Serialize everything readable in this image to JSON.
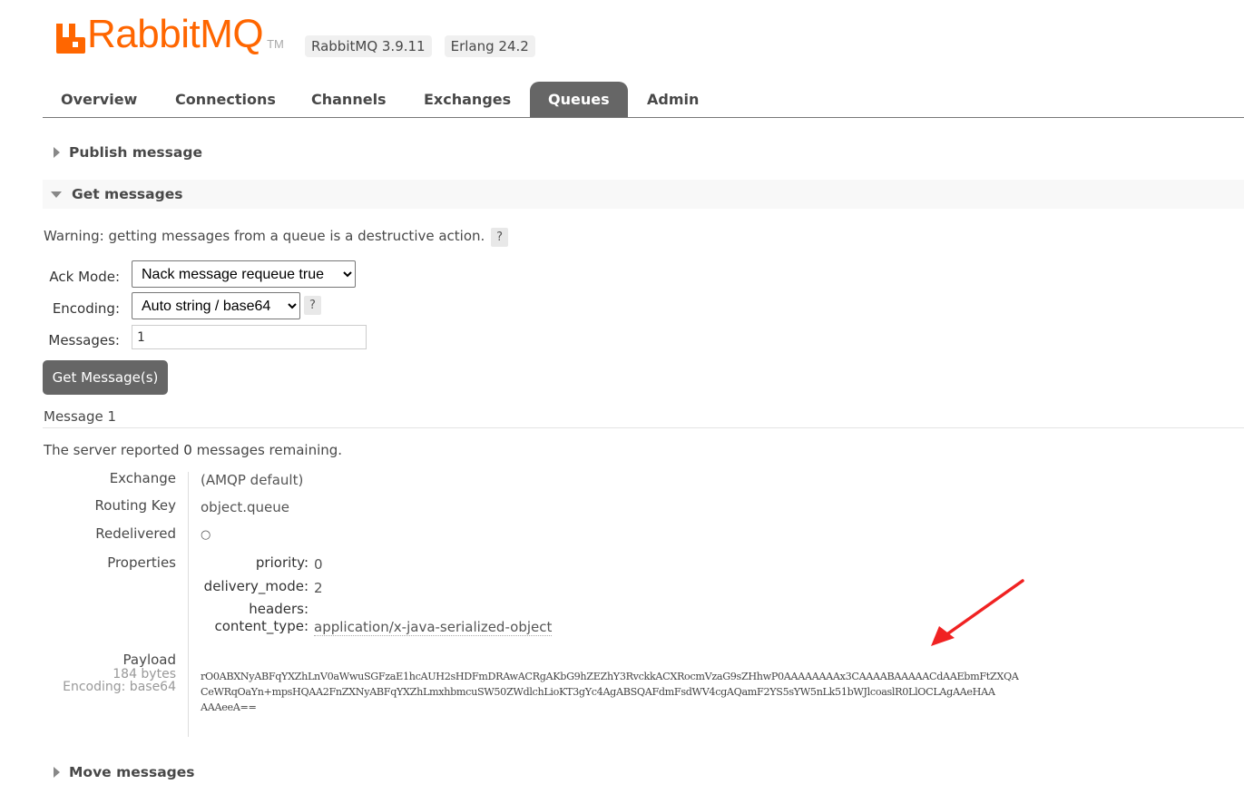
{
  "header": {
    "brand": "RabbitMQ",
    "tm": "TM",
    "versions": [
      "RabbitMQ 3.9.11",
      "Erlang 24.2"
    ],
    "accent_color": "#ff6600"
  },
  "tabs": [
    {
      "label": "Overview",
      "active": false
    },
    {
      "label": "Connections",
      "active": false
    },
    {
      "label": "Channels",
      "active": false
    },
    {
      "label": "Exchanges",
      "active": false
    },
    {
      "label": "Queues",
      "active": true
    },
    {
      "label": "Admin",
      "active": false
    }
  ],
  "sections": {
    "publish": "Publish message",
    "get": "Get messages",
    "move": "Move messages"
  },
  "get_form": {
    "warning": "Warning: getting messages from a queue is a destructive action.",
    "help_glyph": "?",
    "ack_mode_label": "Ack Mode:",
    "ack_mode_value": "Nack message requeue true",
    "encoding_label": "Encoding:",
    "encoding_value": "Auto string / base64",
    "messages_label": "Messages:",
    "messages_value": "1",
    "button": "Get Message(s)"
  },
  "result": {
    "title": "Message 1",
    "remaining_prefix": "The server reported ",
    "remaining_count": "0",
    "remaining_suffix": " messages remaining.",
    "exchange_label": "Exchange",
    "exchange_value": "(AMQP default)",
    "routing_key_label": "Routing Key",
    "routing_key_value": "object.queue",
    "redelivered_label": "Redelivered",
    "redelivered_value": "○",
    "properties_label": "Properties",
    "properties": {
      "priority_key": "priority:",
      "priority_val": "0",
      "delivery_mode_key": "delivery_mode:",
      "delivery_mode_val": "2",
      "headers_key": "headers:",
      "content_type_key": "content_type:",
      "content_type_val": "application/x-java-serialized-object"
    },
    "payload_label": "Payload",
    "payload_size": "184 bytes",
    "payload_encoding": "Encoding: base64",
    "payload": "rO0ABXNyABFqYXZhLnV0aWwuSGFzaE1hcAUH2sHDFmDRAwACRgAKbG9hZEZhY3RvckkACXRocmVzaG9sZHhwP0AAAAAAAAx3CAAAABAAAAACdAAEbmFtZXQA\nCeWRqOaYn+mpsHQAA2FnZXNyABFqYXZhLmxhbmcuSW50ZWdlchLioKT3gYc4AgABSQAFdmFsdWV4cgAQamF2YS5sYW5nLk51bWJlcoaslR0LlOCLAgAAeHAA\nAAAeeA=="
  },
  "annotation": {
    "arrow_color": "#f02222"
  }
}
